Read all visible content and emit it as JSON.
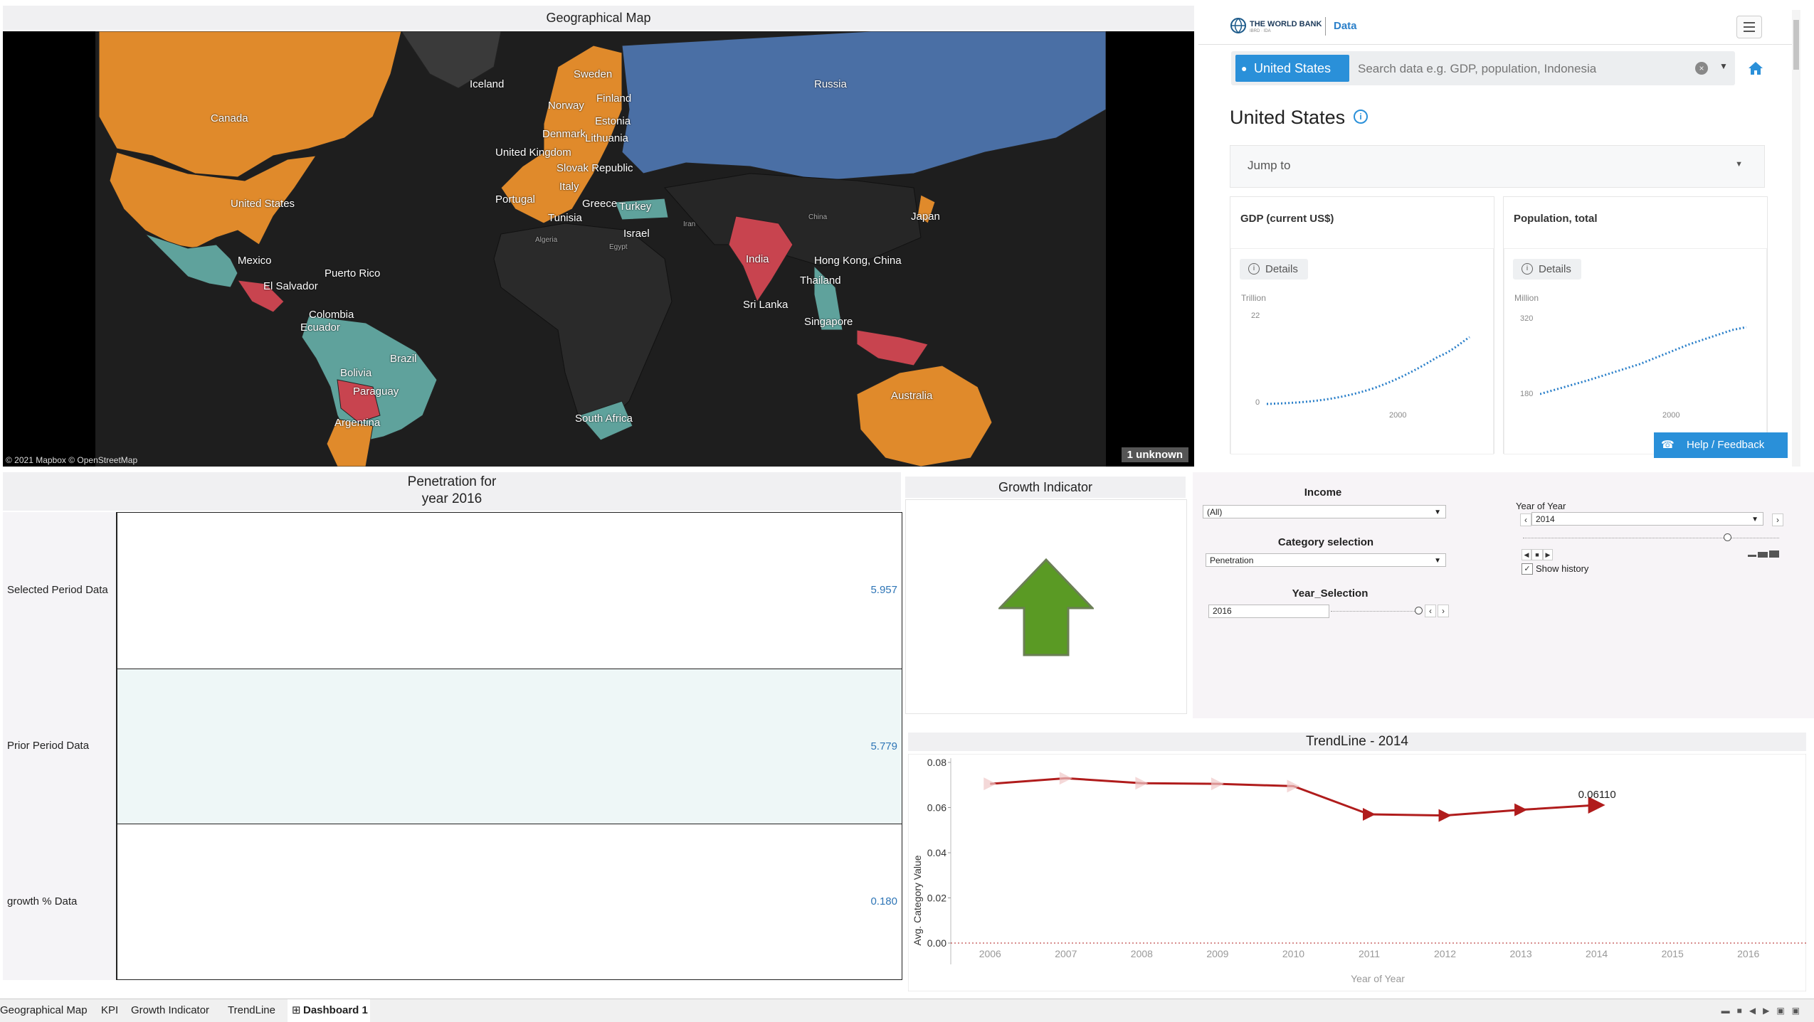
{
  "map": {
    "title": "Geographical Map",
    "attribution": "© 2021 Mapbox © OpenStreetMap",
    "unknown_badge": "1 unknown",
    "countries": [
      "Canada",
      "United States",
      "Mexico",
      "El Salvador",
      "Puerto Rico",
      "Colombia",
      "Ecuador",
      "Brazil",
      "Bolivia",
      "Paraguay",
      "Argentina",
      "Iceland",
      "Sweden",
      "Norway",
      "Finland",
      "Estonia",
      "Denmark",
      "Lithuania",
      "United Kingdom",
      "Slovak Republic",
      "Italy",
      "Portugal",
      "Greece",
      "Turkey",
      "Tunisia",
      "Israel",
      "Russia",
      "India",
      "Sri Lanka",
      "Hong Kong, China",
      "Thailand",
      "Singapore",
      "Japan",
      "Australia",
      "South Africa"
    ],
    "faint_labels": [
      "Algeria",
      "Egypt",
      "Iran",
      "China"
    ]
  },
  "worldbank": {
    "brand": "THE WORLD BANK",
    "brand_sub": "IBRD · IDA",
    "section": "Data",
    "country_button": "United States",
    "search_placeholder": "Search data e.g. GDP, population, Indonesia",
    "page_heading": "United States",
    "jump_to": "Jump to",
    "cards": [
      {
        "title": "GDP (current US$)",
        "details": "Details",
        "unit": "Trillion",
        "y_top": "22",
        "y_bottom": "0",
        "x_label": "2000"
      },
      {
        "title": "Population, total",
        "details": "Details",
        "unit": "Million",
        "y_top": "320",
        "y_bottom": "180",
        "x_label": "2000"
      }
    ],
    "help_button": "Help / Feedback"
  },
  "kpi": {
    "title_line1": "Penetration for",
    "title_line2": "year 2016",
    "rows": [
      {
        "label": "Selected Period Data",
        "value": "5.957"
      },
      {
        "label": "Prior Period Data",
        "value": "5.779"
      },
      {
        "label": "growth % Data",
        "value": "0.180"
      }
    ]
  },
  "growth": {
    "title": "Growth Indicator",
    "direction": "up",
    "arrow_color": "#5a9a24"
  },
  "filters": {
    "income_title": "Income",
    "income_value": "(All)",
    "category_title": "Category selection",
    "category_value": "Penetration",
    "year_sel_title": "Year_Selection",
    "year_sel_value": "2016",
    "year_of_year_title": "Year of Year",
    "year_of_year_value": "2014",
    "show_history": "Show history"
  },
  "trend": {
    "title": "TrendLine - 2014",
    "point_label": "0.06110"
  },
  "chart_data": {
    "type": "line",
    "title": "TrendLine - 2014",
    "xlabel": "Year of Year",
    "ylabel": "Avg. Category Value",
    "x": [
      2006,
      2007,
      2008,
      2009,
      2010,
      2011,
      2012,
      2013,
      2014,
      2015,
      2016
    ],
    "series": [
      {
        "values": [
          0.0705,
          0.073,
          0.0708,
          0.0705,
          0.0695,
          0.057,
          0.0565,
          0.059,
          0.0611,
          null,
          null
        ]
      }
    ],
    "y_ticks": [
      "0.00",
      "0.02",
      "0.04",
      "0.06",
      "0.08"
    ],
    "ylim": [
      0,
      0.08
    ],
    "color": "#b01c1c",
    "annotation": "0.06110"
  },
  "tabs": [
    "Geographical Map",
    "KPI",
    "Growth Indicator",
    "TrendLine",
    "Dashboard 1"
  ],
  "active_tab": "Dashboard 1"
}
